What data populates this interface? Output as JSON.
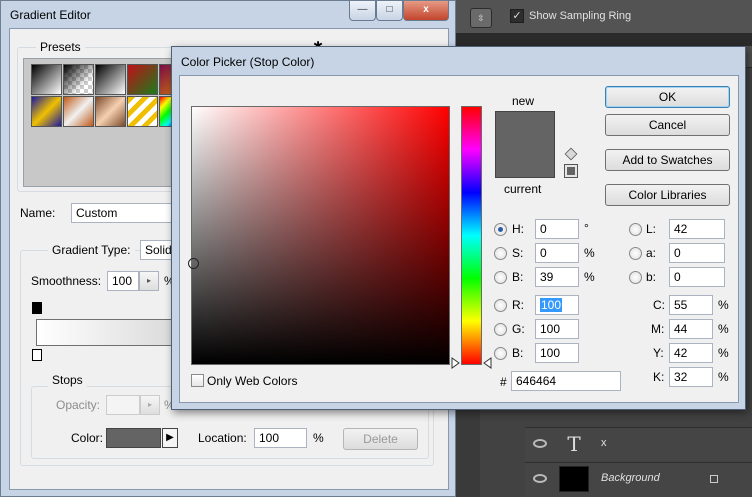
{
  "photoshop": {
    "options_bar": {
      "show_sampling_ring_label": "Show Sampling Ring",
      "show_sampling_ring_checked": true
    },
    "layers": [
      {
        "name": "x",
        "kind": "text"
      },
      {
        "name": "Background",
        "kind": "image",
        "locked": true
      }
    ],
    "colors": {
      "panel_bg": "#424242",
      "close_red": "#c0392b"
    }
  },
  "gradient_editor": {
    "title": "Gradient Editor",
    "presets_label": "Presets",
    "name_label": "Name:",
    "name_value": "Custom",
    "gradient_type_label": "Gradient Type:",
    "gradient_type_value": "Solid",
    "smoothness_label": "Smoothness:",
    "smoothness_value": "100",
    "smoothness_unit": "%",
    "stops_label": "Stops",
    "opacity_label": "Opacity:",
    "opacity_unit": "%",
    "color_label": "Color:",
    "color_value": "#646464",
    "location_label": "Location:",
    "location_value": "100",
    "location_unit": "%",
    "delete_label": "Delete",
    "window_buttons": {
      "minimize": "—",
      "maximize": "□",
      "close": "x"
    },
    "settings_icon": "✱"
  },
  "color_picker": {
    "title": "Color Picker (Stop Color)",
    "new_label": "new",
    "current_label": "current",
    "new_color": "#646464",
    "current_color": "#646464",
    "buttons": {
      "ok": "OK",
      "cancel": "Cancel",
      "add_to_swatches": "Add to Swatches",
      "color_libraries": "Color Libraries"
    },
    "only_web_colors_label": "Only Web Colors",
    "hsb": [
      {
        "label": "H:",
        "value": "0",
        "unit": "°",
        "selected": true
      },
      {
        "label": "S:",
        "value": "0",
        "unit": "%",
        "selected": false
      },
      {
        "label": "B:",
        "value": "39",
        "unit": "%",
        "selected": false
      }
    ],
    "rgb": [
      {
        "label": "R:",
        "value": "100"
      },
      {
        "label": "G:",
        "value": "100"
      },
      {
        "label": "B:",
        "value": "100"
      }
    ],
    "lab": [
      {
        "label": "L:",
        "value": "42"
      },
      {
        "label": "a:",
        "value": "0"
      },
      {
        "label": "b:",
        "value": "0"
      }
    ],
    "cmyk": [
      {
        "label": "C:",
        "value": "55",
        "unit": "%"
      },
      {
        "label": "M:",
        "value": "44",
        "unit": "%"
      },
      {
        "label": "Y:",
        "value": "42",
        "unit": "%"
      },
      {
        "label": "K:",
        "value": "32",
        "unit": "%"
      }
    ],
    "hex_label": "#",
    "hex_value": "646464"
  }
}
